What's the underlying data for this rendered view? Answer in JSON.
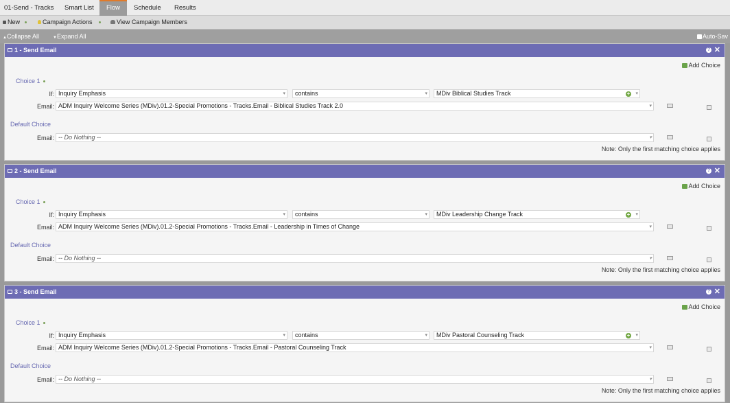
{
  "tabs": [
    {
      "label": "01-Send - Tracks"
    },
    {
      "label": "Smart List"
    },
    {
      "label": "Flow"
    },
    {
      "label": "Schedule"
    },
    {
      "label": "Results"
    }
  ],
  "actionbar": {
    "new_label": "New",
    "campaign_actions_label": "Campaign Actions",
    "view_members_label": "View Campaign Members"
  },
  "canvasbar": {
    "collapse_label": "Collapse All",
    "expand_label": "Expand All",
    "autosave_label": "Auto-Sav"
  },
  "common": {
    "add_choice": "Add Choice",
    "choice1": "Choice 1",
    "default_choice": "Default Choice",
    "if_label": "If:",
    "email_label": "Email:",
    "do_nothing": "-- Do Nothing --",
    "note": "Note: Only the first matching choice applies",
    "help": "?",
    "close": "✕",
    "dropdown_arrow": "▾"
  },
  "steps": [
    {
      "title": "1 - Send Email",
      "attribute": "Inquiry Emphasis",
      "operator": "contains",
      "value": "MDiv Biblical Studies Track",
      "email": "ADM Inquiry Welcome Series (MDiv).01.2-Special Promotions - Tracks.Email - Biblical Studies Track 2.0"
    },
    {
      "title": "2 - Send Email",
      "attribute": "Inquiry Emphasis",
      "operator": "contains",
      "value": "MDiv Leadership Change Track",
      "email": "ADM Inquiry Welcome Series (MDiv).01.2-Special Promotions - Tracks.Email - Leadership in Times of Change"
    },
    {
      "title": "3 - Send Email",
      "attribute": "Inquiry Emphasis",
      "operator": "contains",
      "value": "MDiv Pastoral Counseling Track",
      "email": "ADM Inquiry Welcome Series (MDiv).01.2-Special Promotions - Tracks.Email - Pastoral Counseling Track"
    }
  ],
  "colors": {
    "panel_header": "#6d6cb4",
    "active_tab_accent": "#e07a2a",
    "choice_label": "#6466b0",
    "add_green": "#72a744"
  }
}
